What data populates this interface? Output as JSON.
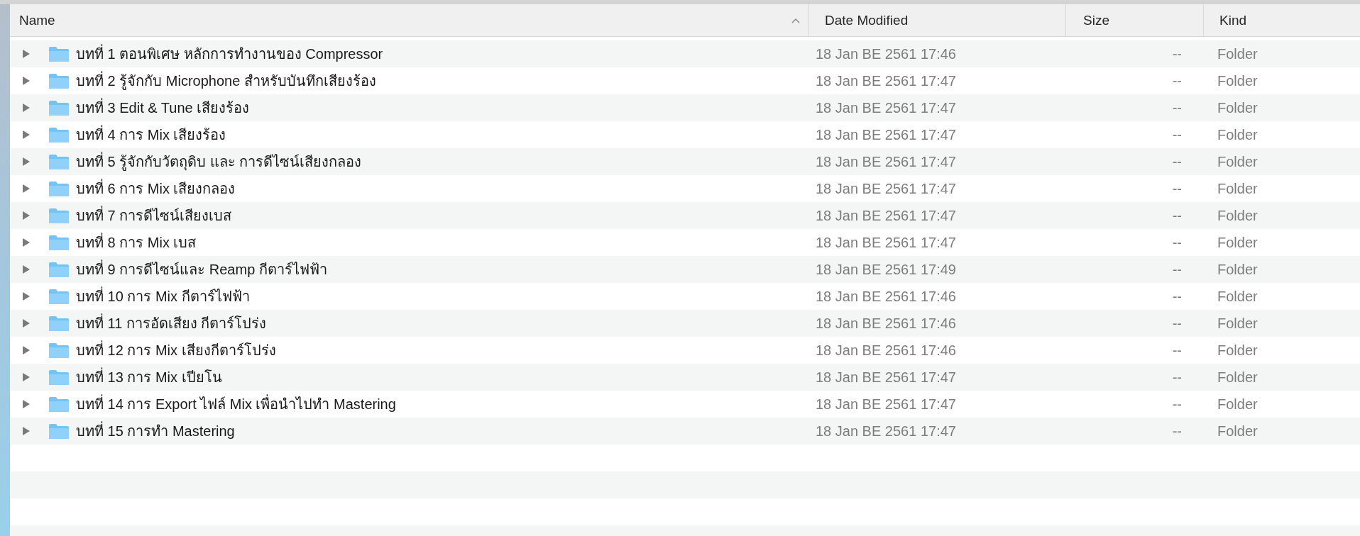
{
  "columns": [
    {
      "label": "Name",
      "sorted": true
    },
    {
      "label": "Date Modified",
      "sorted": false
    },
    {
      "label": "Size",
      "sorted": false
    },
    {
      "label": "Kind",
      "sorted": false
    }
  ],
  "rows": [
    {
      "name": "บทที่ 1 ตอนพิเศษ หลักการทำงานของ Compressor",
      "date": "18 Jan BE 2561 17:46",
      "size": "--",
      "kind": "Folder",
      "expanded": false
    },
    {
      "name": "บทที่ 2 รู้จักกับ Microphone สำหรับบันทึกเสียงร้อง",
      "date": "18 Jan BE 2561 17:47",
      "size": "--",
      "kind": "Folder",
      "expanded": false
    },
    {
      "name": "บทที่ 3 Edit & Tune เสียงร้อง",
      "date": "18 Jan BE 2561 17:47",
      "size": "--",
      "kind": "Folder",
      "expanded": false
    },
    {
      "name": "บทที่ 4 การ Mix เสียงร้อง",
      "date": "18 Jan BE 2561 17:47",
      "size": "--",
      "kind": "Folder",
      "expanded": false
    },
    {
      "name": "บทที่ 5 รู้จักกับวัตถุดิบ และ การดีไซน์เสียงกลอง",
      "date": "18 Jan BE 2561 17:47",
      "size": "--",
      "kind": "Folder",
      "expanded": false
    },
    {
      "name": "บทที่ 6 การ Mix เสียงกลอง",
      "date": "18 Jan BE 2561 17:47",
      "size": "--",
      "kind": "Folder",
      "expanded": false
    },
    {
      "name": "บทที่ 7 การดีไซน์เสียงเบส",
      "date": "18 Jan BE 2561 17:47",
      "size": "--",
      "kind": "Folder",
      "expanded": false
    },
    {
      "name": "บทที่ 8 การ Mix เบส",
      "date": "18 Jan BE 2561 17:47",
      "size": "--",
      "kind": "Folder",
      "expanded": false
    },
    {
      "name": "บทที่ 9 การดีไซน์และ Reamp กีตาร์ไฟฟ้า",
      "date": "18 Jan BE 2561 17:49",
      "size": "--",
      "kind": "Folder",
      "expanded": false
    },
    {
      "name": "บทที่ 10 การ Mix กีตาร์ไฟฟ้า",
      "date": "18 Jan BE 2561 17:46",
      "size": "--",
      "kind": "Folder",
      "expanded": false
    },
    {
      "name": "บทที่ 11 การอัดเสียง กีตาร์โปร่ง",
      "date": "18 Jan BE 2561 17:46",
      "size": "--",
      "kind": "Folder",
      "expanded": false
    },
    {
      "name": "บทที่ 12 การ Mix เสียงกีตาร์โปร่ง",
      "date": "18 Jan BE 2561 17:46",
      "size": "--",
      "kind": "Folder",
      "expanded": false
    },
    {
      "name": "บทที่ 13 การ Mix เปียโน",
      "date": "18 Jan BE 2561 17:47",
      "size": "--",
      "kind": "Folder",
      "expanded": false
    },
    {
      "name": "บทที่ 14 การ Export ไฟล์ Mix เพื่อนำไปทำ Mastering",
      "date": "18 Jan BE 2561 17:47",
      "size": "--",
      "kind": "Folder",
      "expanded": false
    },
    {
      "name": "บทที่ 15 การทำ Mastering",
      "date": "18 Jan BE 2561 17:47",
      "size": "--",
      "kind": "Folder",
      "expanded": false
    }
  ]
}
